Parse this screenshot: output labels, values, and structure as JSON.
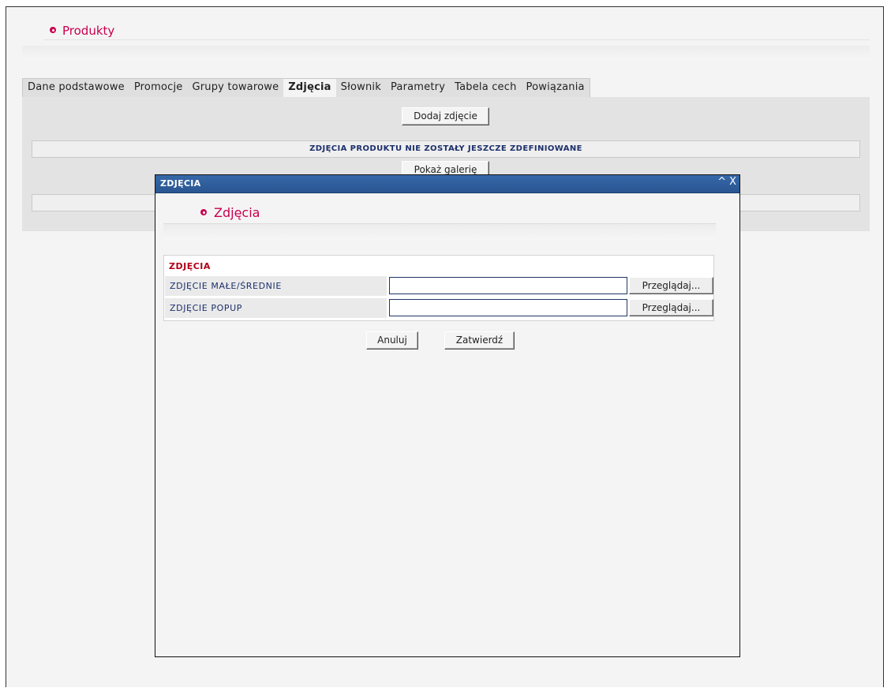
{
  "page": {
    "title": "Produkty"
  },
  "tabs": [
    {
      "label": "Dane podstawowe"
    },
    {
      "label": "Promocje"
    },
    {
      "label": "Grupy towarowe"
    },
    {
      "label": "Zdjęcia",
      "active": true
    },
    {
      "label": "Słownik"
    },
    {
      "label": "Parametry"
    },
    {
      "label": "Tabela cech"
    },
    {
      "label": "Powiązania"
    }
  ],
  "content": {
    "add_photo_button": "Dodaj zdjęcie",
    "no_photos_message": "Zdjęcia produktu nie zostały jeszcze zdefiniowane",
    "show_gallery_button": "Pokaż galerię"
  },
  "modal": {
    "titlebar": "Zdjęcia",
    "minimize_glyph": "^",
    "close_glyph": "X",
    "heading": "Zdjęcia",
    "form": {
      "section_title": "Zdjęcia",
      "rows": [
        {
          "label": "Zdjęcie małe/średnie",
          "value": "",
          "browse_label": "Przeglądaj..."
        },
        {
          "label": "Zdjęcie popup",
          "value": "",
          "browse_label": "Przeglądaj..."
        }
      ]
    },
    "cancel_button": "Anuluj",
    "confirm_button": "Zatwierdź"
  },
  "colors": {
    "accent": "#c8004f",
    "titlebar": "#2f5d9c",
    "label_text": "#1c2f6b"
  }
}
